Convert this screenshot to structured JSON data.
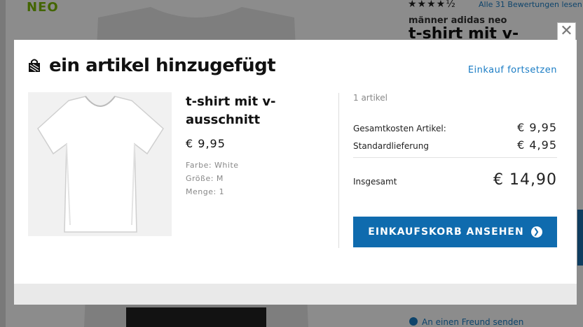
{
  "background": {
    "brand_tag": "NEO",
    "stars": "★★★★½",
    "reviews_link": "Alle 31 Bewertungen lesen",
    "category": "männer adidas neo",
    "product_title": "t-shirt mit v-",
    "send_friend": "An einen Freund senden"
  },
  "modal": {
    "title": "ein artikel hinzugefügt",
    "continue_link": "Einkauf fortsetzen",
    "close_glyph": "✕",
    "product": {
      "name": "t-shirt mit v-ausschnitt",
      "price": "€ 9,95",
      "color": "Farbe: White",
      "size": "Größe: M",
      "quantity": "Menge: 1"
    },
    "summary": {
      "item_count": "1 artikel",
      "subtotal_label": "Gesamtkosten Artikel:",
      "subtotal_value": "€ 9,95",
      "shipping_label": "Standardlieferung",
      "shipping_value": "€ 4,95",
      "total_label": "Insgesamt",
      "total_value": "€ 14,90"
    },
    "cart_button_label": "EINKAUFSKORB ANSEHEN",
    "cart_button_arrow": "❯"
  },
  "colors": {
    "accent_blue": "#0f6bae",
    "link_blue": "#1a7cc4",
    "neo_green": "#7ab800"
  }
}
